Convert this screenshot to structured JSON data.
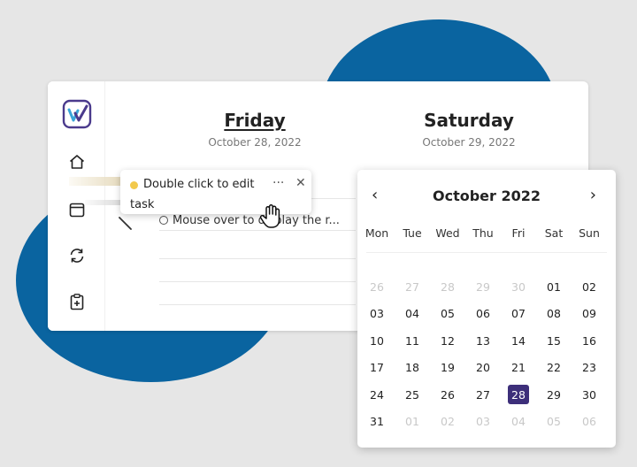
{
  "colors": {
    "accent_blue": "#0a64a0",
    "selected_day": "#3d2f7a",
    "task_dot": "#f2c94c"
  },
  "sidebar": {
    "items": [
      {
        "icon": "home-icon"
      },
      {
        "icon": "calendar-icon"
      },
      {
        "icon": "sync-icon"
      },
      {
        "icon": "clipboard-add-icon"
      }
    ]
  },
  "days": [
    {
      "name": "Friday",
      "date": "October 28, 2022"
    },
    {
      "name": "Saturday",
      "date": "October 29, 2022"
    }
  ],
  "tasks": [
    {
      "text": "Mouse over to display the r..."
    }
  ],
  "tooltip": {
    "line1": "Double click to edit",
    "line2": "task",
    "more": "···",
    "close": "✕"
  },
  "calendar": {
    "title": "October 2022",
    "prev": "‹",
    "next": "›",
    "weekdays": [
      "Mon",
      "Tue",
      "Wed",
      "Thu",
      "Fri",
      "Sat",
      "Sun"
    ],
    "days": [
      {
        "label": "26",
        "muted": true
      },
      {
        "label": "27",
        "muted": true
      },
      {
        "label": "28",
        "muted": true
      },
      {
        "label": "29",
        "muted": true
      },
      {
        "label": "30",
        "muted": true
      },
      {
        "label": "01"
      },
      {
        "label": "02"
      },
      {
        "label": "03"
      },
      {
        "label": "04"
      },
      {
        "label": "05"
      },
      {
        "label": "06"
      },
      {
        "label": "07"
      },
      {
        "label": "08"
      },
      {
        "label": "09"
      },
      {
        "label": "10"
      },
      {
        "label": "11"
      },
      {
        "label": "12"
      },
      {
        "label": "13"
      },
      {
        "label": "14"
      },
      {
        "label": "15"
      },
      {
        "label": "16"
      },
      {
        "label": "17"
      },
      {
        "label": "18"
      },
      {
        "label": "19"
      },
      {
        "label": "20"
      },
      {
        "label": "21"
      },
      {
        "label": "22"
      },
      {
        "label": "23"
      },
      {
        "label": "24"
      },
      {
        "label": "25"
      },
      {
        "label": "26"
      },
      {
        "label": "27"
      },
      {
        "label": "28",
        "selected": true
      },
      {
        "label": "29"
      },
      {
        "label": "30"
      },
      {
        "label": "31"
      },
      {
        "label": "01",
        "muted": true
      },
      {
        "label": "02",
        "muted": true
      },
      {
        "label": "03",
        "muted": true
      },
      {
        "label": "04",
        "muted": true
      },
      {
        "label": "05",
        "muted": true
      },
      {
        "label": "06",
        "muted": true
      }
    ]
  }
}
